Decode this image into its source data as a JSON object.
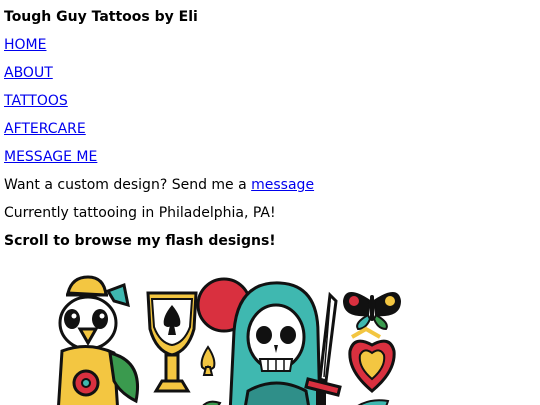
{
  "site": {
    "title": "Tough Guy Tattoos by Eli"
  },
  "nav": {
    "items": [
      {
        "label": "HOME"
      },
      {
        "label": "ABOUT"
      },
      {
        "label": "TATTOOS"
      },
      {
        "label": "AFTERCARE"
      },
      {
        "label": "MESSAGE ME"
      }
    ]
  },
  "content": {
    "custom_prefix": "Want a custom design? Send me a ",
    "custom_link": "message",
    "location": "Currently tattooing in Philadelphia, PA!",
    "scroll_hint": "Scroll to browse my flash designs!"
  },
  "flash_image": {
    "subjects": [
      "duck-with-hat",
      "goblet-with-spade",
      "skeleton-with-dagger",
      "butterfly",
      "sacred-heart",
      "red-moon",
      "green-leaf"
    ]
  },
  "colors": {
    "link": "#0000ee",
    "text": "#000000",
    "red": "#d9303f",
    "teal": "#3fb8b0",
    "yellow": "#f3c641",
    "ink": "#111111"
  }
}
